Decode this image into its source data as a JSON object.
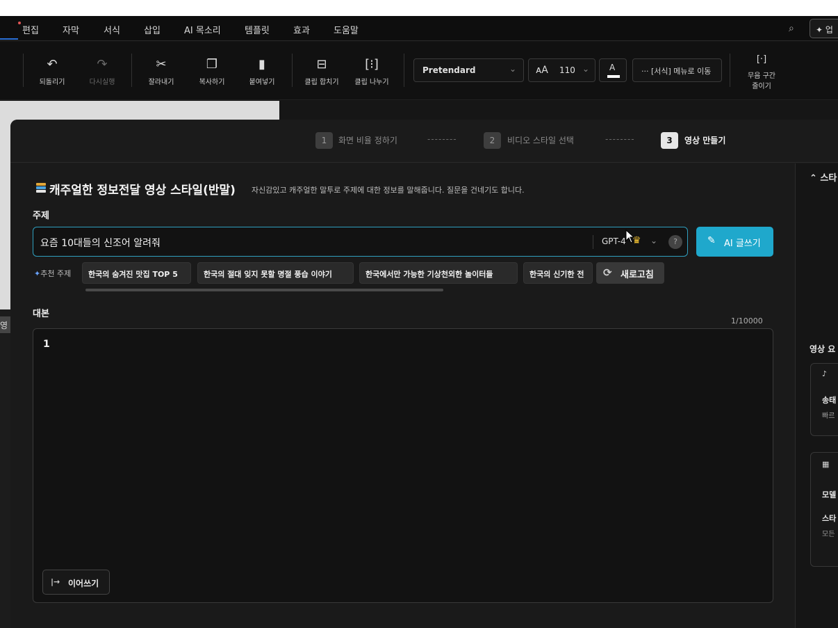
{
  "menu": {
    "items": [
      "편집",
      "자막",
      "서식",
      "삽입",
      "AI 목소리",
      "템플릿",
      "효과",
      "도움말"
    ],
    "cta_label": "업"
  },
  "toolbar": {
    "undo": "되돌리기",
    "redo": "다시실행",
    "cut": "잘라내기",
    "copy": "복사하기",
    "paste": "붙여넣기",
    "merge_clip": "클립 합치기",
    "split_clip": "클립 나누기",
    "font_value": "Pretendard",
    "font_size_value": "110",
    "text_color_label": "A",
    "format_menu": "··· [서식] 메뉴로 이동",
    "silence_line1": "무음 구간",
    "silence_line2": "줄이기"
  },
  "steps": [
    {
      "num": "1",
      "label": "화면 비율 정하기",
      "active": false
    },
    {
      "num": "2",
      "label": "비디오 스타일 선택",
      "active": false
    },
    {
      "num": "3",
      "label": "영상 만들기",
      "active": true
    }
  ],
  "step_separator": "--------",
  "style": {
    "title": "캐주얼한 정보전달 영상 스타일(반말)",
    "description": "자신감있고 캐주얼한 말투로 주제에 대한 정보를 말해줍니다. 질문을 건네기도 합니다."
  },
  "topic": {
    "label": "주제",
    "value": "요즘 10대들의 신조어 알려줘",
    "model": "GPT-4",
    "help": "?",
    "ai_button": "AI 글쓰기"
  },
  "recommend": {
    "label": "추천 주제",
    "chips": [
      "한국의 숨겨진 맛집 TOP 5",
      "한국의 절대 잊지 못할 명절 풍습 이야기",
      "한국에서만 가능한 기상천외한 놀이터들",
      "한국의 신기한 전"
    ],
    "refresh": "새로고침"
  },
  "script": {
    "label": "대본",
    "counter": "1/10000",
    "value": "1",
    "continue_button": "이어쓰기"
  },
  "side_pane": {
    "header": "스타",
    "section": "영상 요",
    "card1_line1": "송태",
    "card1_line2": "빠르",
    "card2_line1": "모델",
    "card2_line2": "스타",
    "card2_line3": "모든"
  },
  "background": {
    "left_tag": "영상"
  },
  "colors": {
    "accent": "#1fa8cc",
    "focus_border": "#2f9fbf",
    "crown": "#f2c233"
  }
}
